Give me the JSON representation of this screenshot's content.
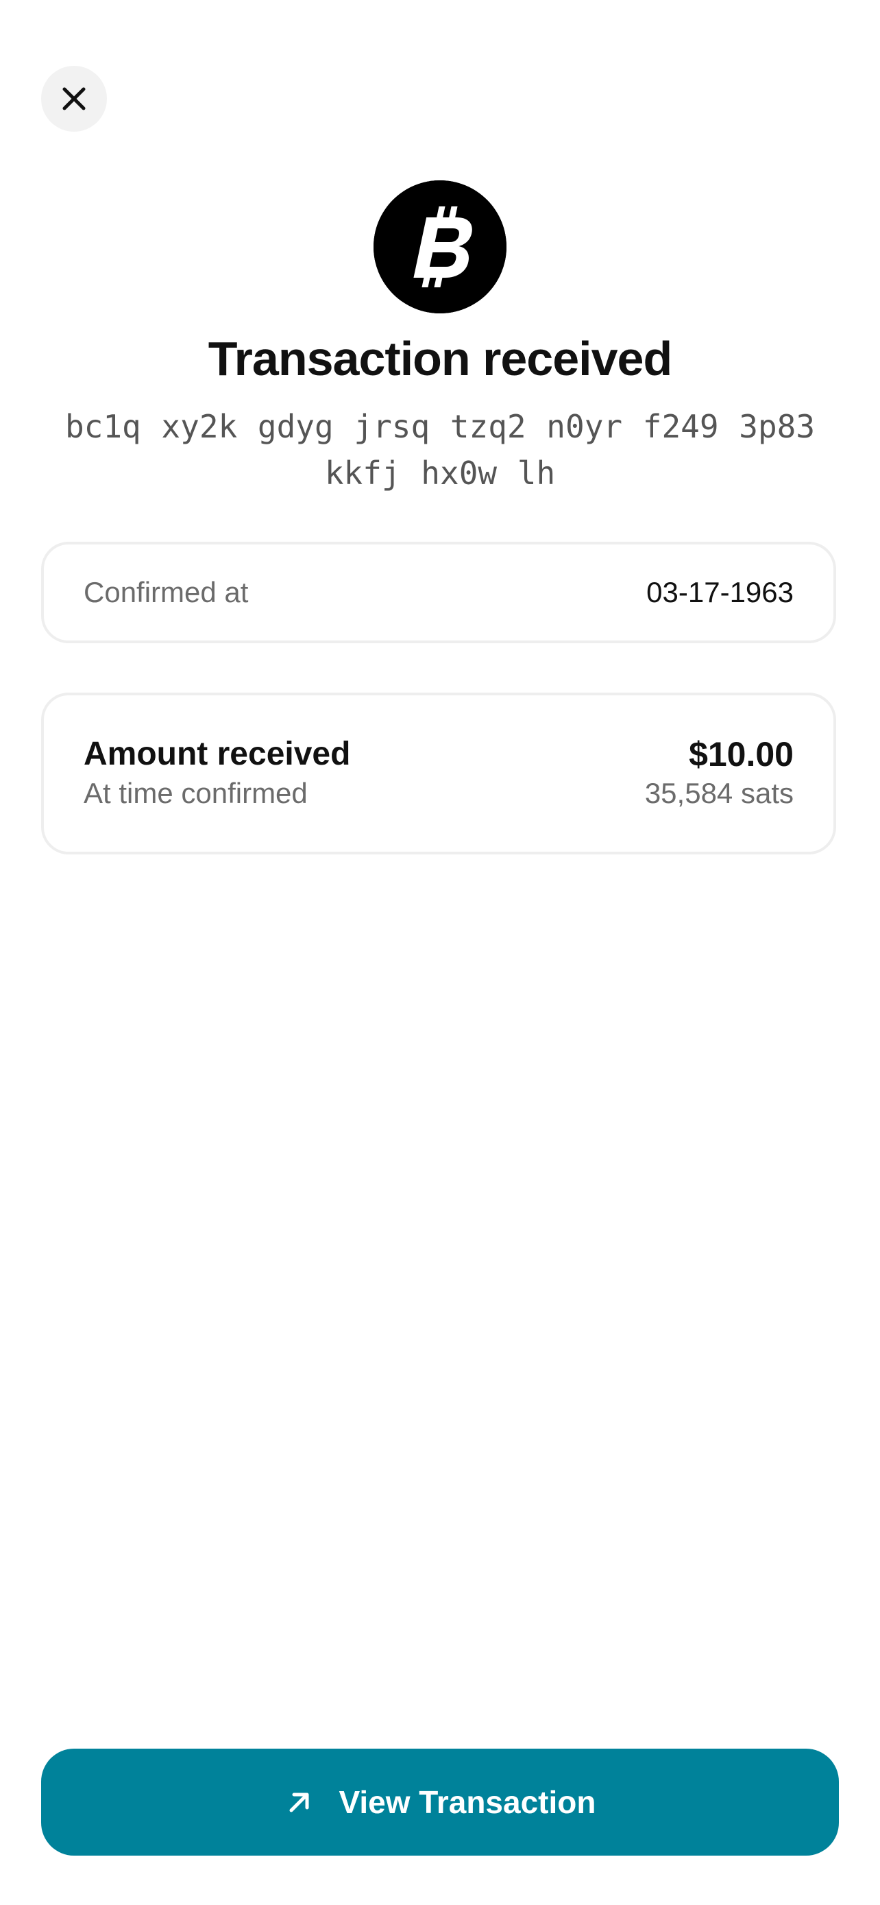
{
  "header": {
    "close_icon": "close-icon",
    "coin_icon": "bitcoin-icon"
  },
  "transaction": {
    "title": "Transaction received",
    "address_line1": "bc1q xy2k gdyg jrsq tzq2 n0yr f249 3p83",
    "address_line2": "kkfj hx0w lh"
  },
  "confirmed": {
    "label": "Confirmed at",
    "value": "03-17-1963"
  },
  "amount": {
    "title": "Amount received",
    "subtitle": "At time confirmed",
    "fiat": "$10.00",
    "sats": "35,584 sats"
  },
  "action": {
    "label": "View Transaction",
    "icon": "arrow-up-right-icon"
  },
  "colors": {
    "accent": "#00829a",
    "coin": "#000000"
  }
}
